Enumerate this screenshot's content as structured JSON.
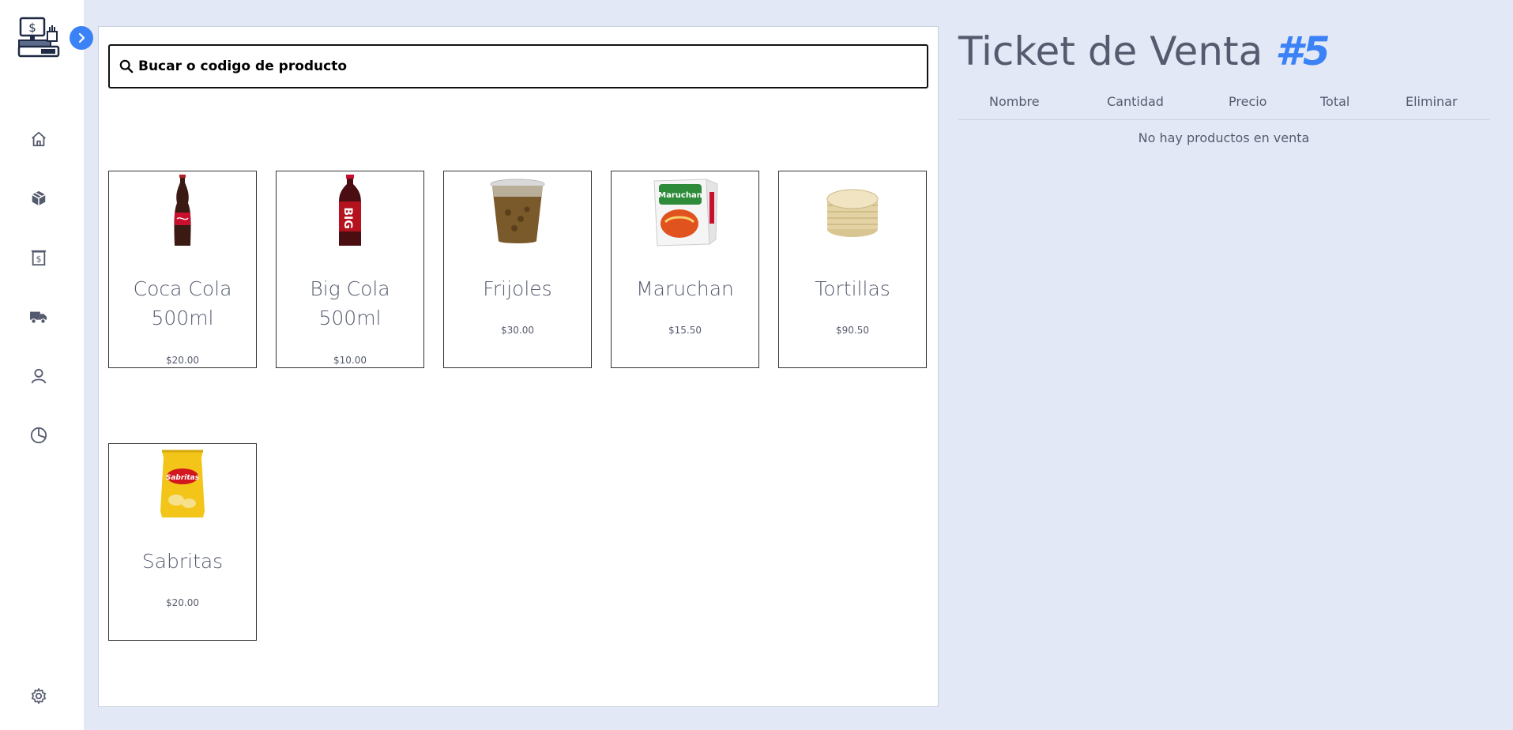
{
  "search": {
    "placeholder": "Bucar o codigo de producto"
  },
  "products": [
    {
      "name": "Coca Cola 500ml",
      "price": "$20.00"
    },
    {
      "name": "Big Cola 500ml",
      "price": "$10.00"
    },
    {
      "name": "Frijoles",
      "price": "$30.00"
    },
    {
      "name": "Maruchan",
      "price": "$15.50"
    },
    {
      "name": "Tortillas",
      "price": "$90.50"
    },
    {
      "name": "Sabritas",
      "price": "$20.00"
    }
  ],
  "ticket": {
    "title": "Ticket de Venta",
    "number": "#5",
    "columns": [
      "Nombre",
      "Cantidad",
      "Precio",
      "Total",
      "Eliminar"
    ],
    "empty_message": "No hay productos en venta"
  },
  "sidebar": {
    "items": [
      "home-icon",
      "box-icon",
      "receipt-icon",
      "truck-icon",
      "user-icon",
      "pie-chart-icon"
    ],
    "bottom": "gear-icon"
  },
  "colors": {
    "accent": "#3b82f6",
    "background": "#e3e8f6",
    "text": "#555b6e"
  }
}
